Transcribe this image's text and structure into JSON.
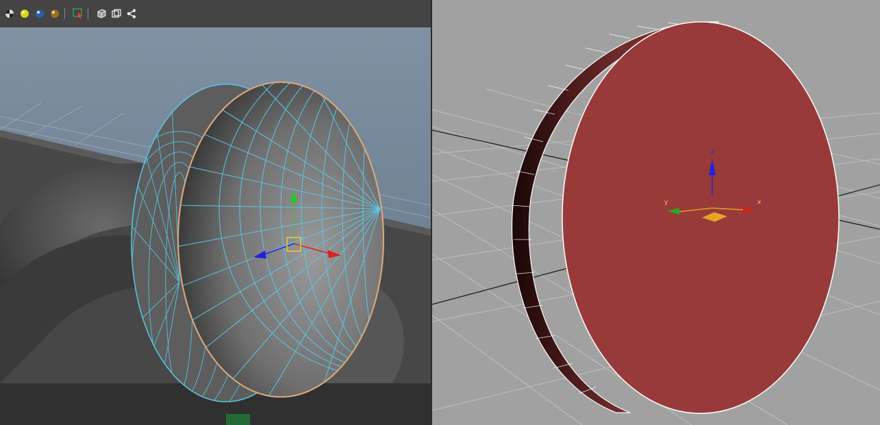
{
  "left_viewport": {
    "toolbar": {
      "icons": [
        "checker-material-icon",
        "yellow-sphere-material-icon",
        "blue-sphere-material-icon",
        "gold-sphere-material-icon",
        "select-region-icon",
        "wire-cube-icon",
        "isolate-view-icon",
        "share-nodes-icon"
      ]
    },
    "mesh": {
      "wire_color": "#58c8e8",
      "rim_color": "#d9a77a"
    },
    "manipulator": {
      "y_color": "#22cc22",
      "x_color": "#dd2222",
      "z_color": "#2222dd"
    }
  },
  "right_viewport": {
    "disc_color": "#983a3a",
    "gizmo": {
      "z_label": "z",
      "y_label": "y",
      "x_label": "x"
    }
  }
}
